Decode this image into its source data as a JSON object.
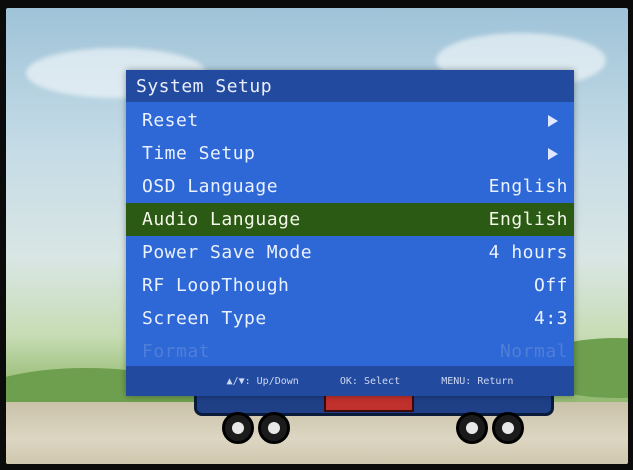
{
  "menu": {
    "title": "System Setup",
    "items": [
      {
        "label": "Reset",
        "value": "",
        "has_arrow": true
      },
      {
        "label": "Time Setup",
        "value": "",
        "has_arrow": true
      },
      {
        "label": "OSD Language",
        "value": "English"
      },
      {
        "label": "Audio Language",
        "value": "English",
        "selected": true
      },
      {
        "label": "Power Save Mode",
        "value": "4 hours"
      },
      {
        "label": "RF LoopThough",
        "value": "Off"
      },
      {
        "label": "Screen Type",
        "value": "4:3"
      },
      {
        "label": "Format",
        "value": "Normal",
        "disabled": true
      }
    ],
    "footer": {
      "updown": "▲/▼: Up/Down",
      "select": "OK: Select",
      "return": "MENU: Return"
    }
  },
  "colors": {
    "menu_bg": "#2e67d6",
    "title_bg": "#224a9e",
    "selected_bg": "#2a5a14",
    "disabled_text": "#4e7fd7"
  },
  "icons": {
    "submenu": "triangle-right"
  }
}
